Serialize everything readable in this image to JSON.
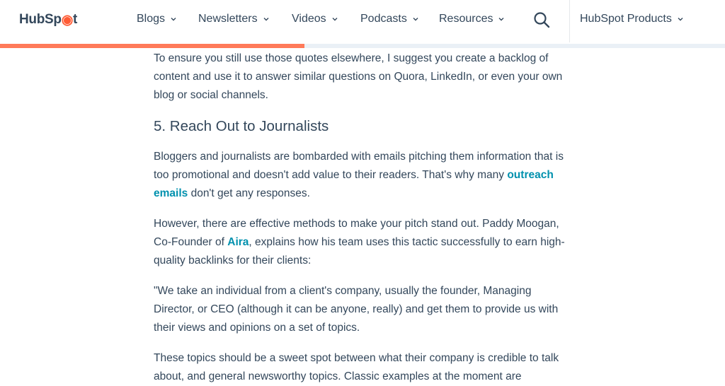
{
  "header": {
    "logo_text_a": "HubSp",
    "logo_text_b": "t",
    "nav": [
      {
        "label": "Blogs"
      },
      {
        "label": "Newsletters"
      },
      {
        "label": "Videos"
      },
      {
        "label": "Podcasts"
      },
      {
        "label": "Resources"
      }
    ],
    "products_label": "HubSpot Products"
  },
  "reading_progress": 0.42,
  "colors": {
    "accent": "#ff7a59",
    "link": "#0091ae",
    "text": "#33475b"
  },
  "article": {
    "p1": "To ensure you still use those quotes elsewhere, I suggest you create a backlog of content and use it to answer similar questions on Quora, LinkedIn, or even your own blog or social channels.",
    "h2": "5. Reach Out to Journalists",
    "p2_a": "Bloggers and journalists are bombarded with emails pitching them information that is too promotional and doesn't add value to their readers. That's why many ",
    "p2_link": "outreach emails",
    "p2_b": " don't get any responses.",
    "p3_a": "However, there are effective methods to make your pitch stand out. Paddy Moogan, Co-Founder of ",
    "p3_link": "Aira",
    "p3_b": ", explains how his team uses this tactic successfully to earn high-quality backlinks for their clients:",
    "p4": "\"We take an individual from a client's company, usually the founder, Managing Director, or CEO (although it can be anyone, really) and get them to provide us with their views and opinions on a set of topics.",
    "p5": "These topics should be a sweet spot between what their company is credible to talk about, and general newsworthy topics. Classic examples at the moment are"
  }
}
